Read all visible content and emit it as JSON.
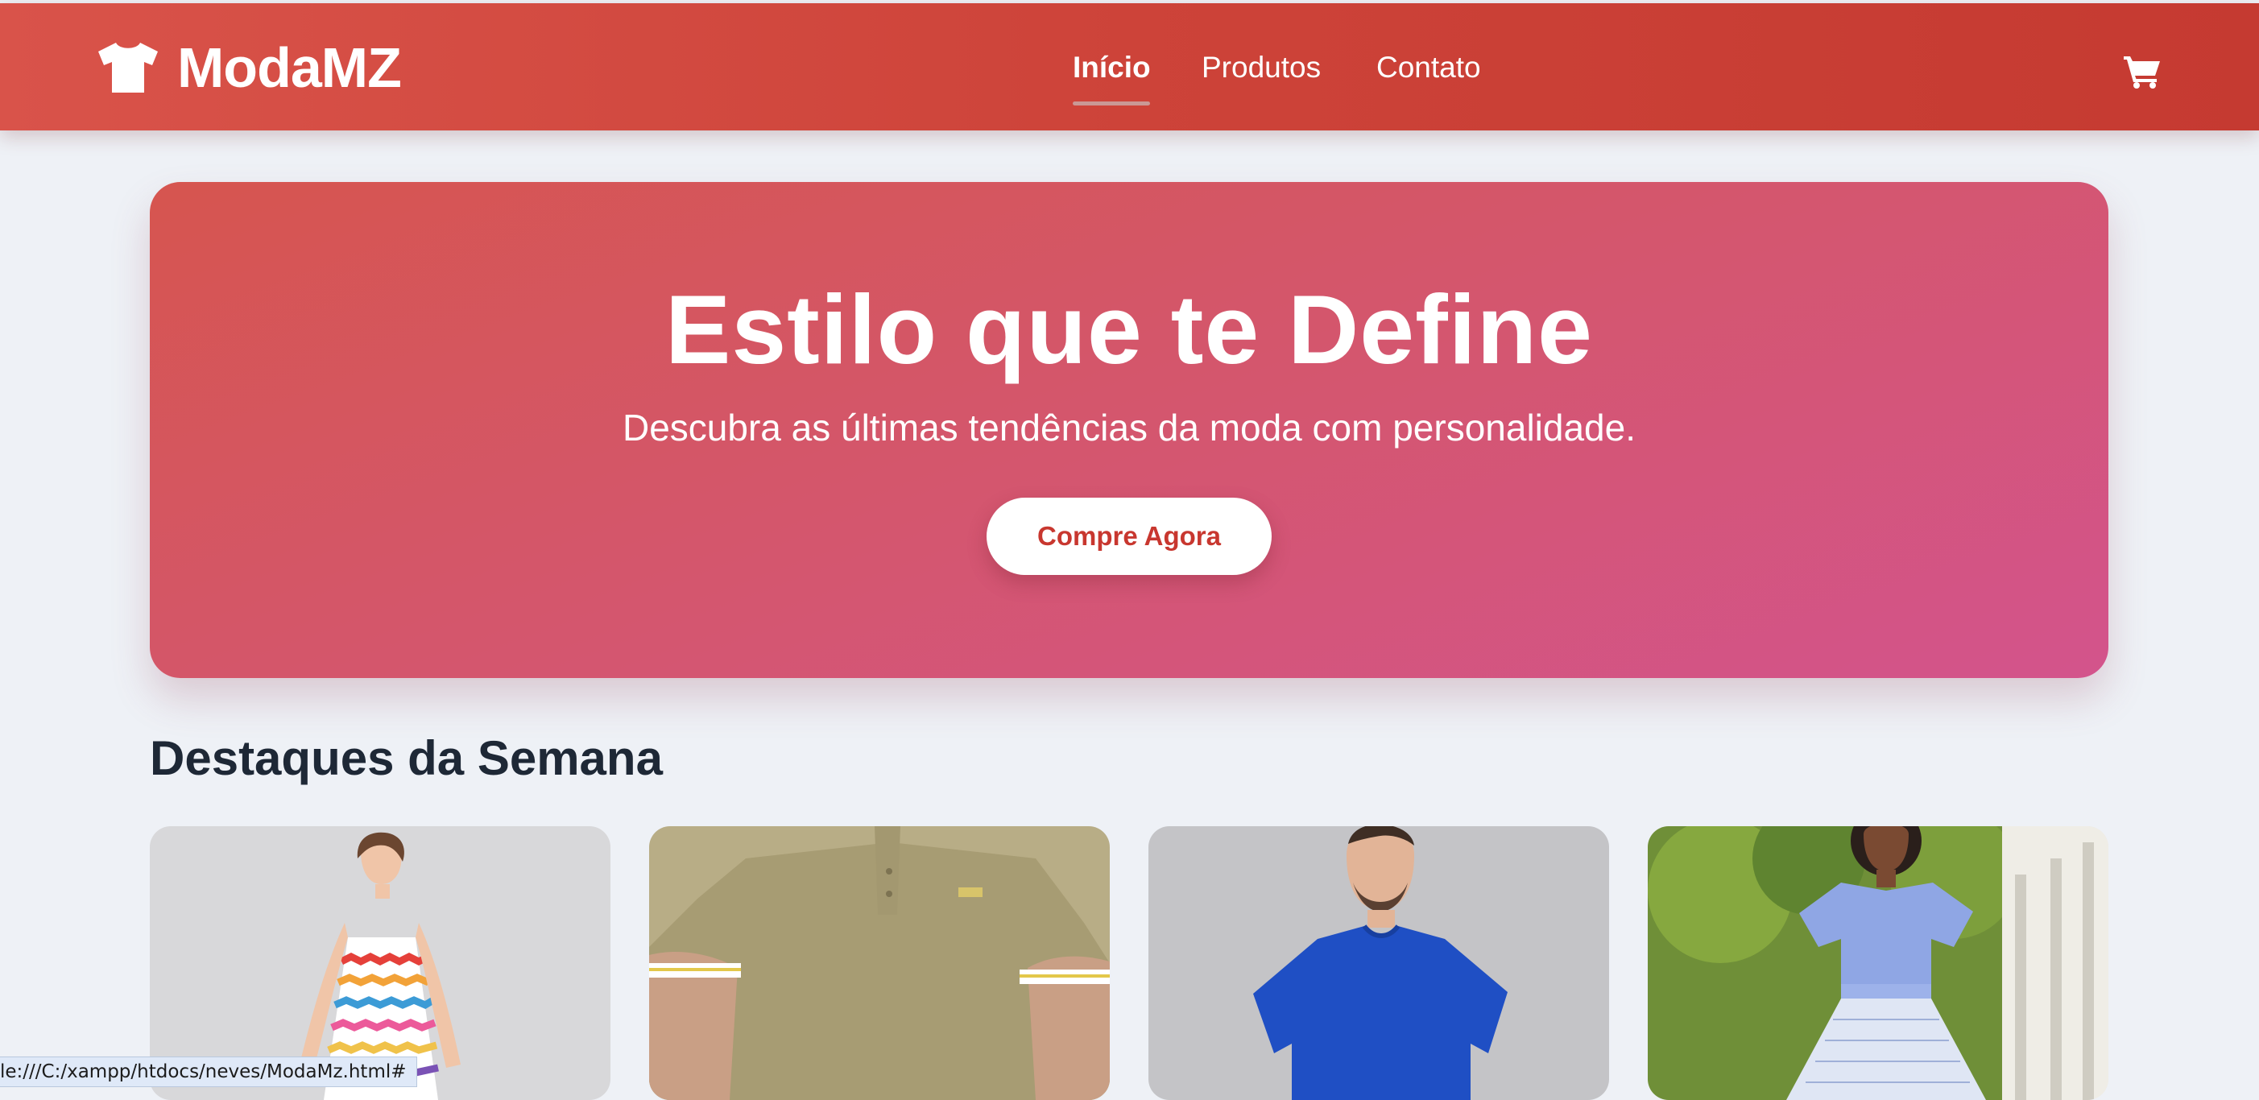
{
  "brand": {
    "name": "ModaMZ",
    "logo_icon": "tshirt-icon"
  },
  "nav": {
    "items": [
      {
        "label": "Início",
        "active": true
      },
      {
        "label": "Produtos",
        "active": false
      },
      {
        "label": "Contato",
        "active": false
      }
    ],
    "cart_icon": "shopping-cart-icon"
  },
  "hero": {
    "title": "Estilo que te Define",
    "subtitle": "Descubra as últimas tendências da moda com personalidade.",
    "button_label": "Compre Agora"
  },
  "featured": {
    "title": "Destaques da Semana",
    "products": [
      {
        "image": "girl in colorful striped dress"
      },
      {
        "image": "khaki polo shirt"
      },
      {
        "image": "man in blue t-shirt"
      },
      {
        "image": "woman in blue off-shoulder top and skirt"
      }
    ]
  },
  "status_bar": {
    "url": "le:///C:/xampp/htdocs/neves/ModaMz.html#"
  },
  "colors": {
    "navbar": "#cd4339",
    "hero_start": "#d6554f",
    "hero_end": "#d3548c",
    "button_text": "#c8372f",
    "page_background": "#eef1f6",
    "heading": "#1e2836"
  }
}
